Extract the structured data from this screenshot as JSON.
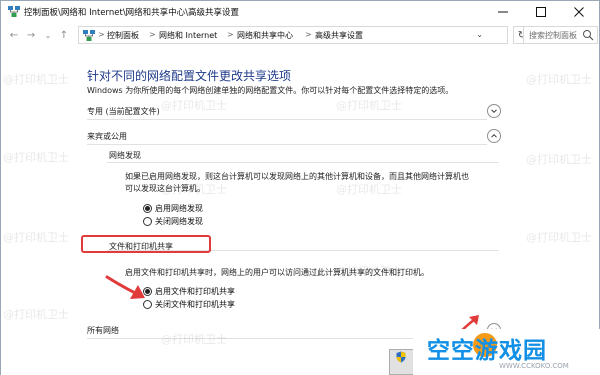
{
  "window": {
    "title": "控制面板\\网络和 Internet\\网络和共享中心\\高级共享设置",
    "minimize_icon": "minimize-icon",
    "maximize_icon": "maximize-icon",
    "close_icon": "close-icon"
  },
  "navbar": {
    "breadcrumbs": [
      "控制面板",
      "网络和 Internet",
      "网络和共享中心",
      "高级共享设置"
    ],
    "separator": ">",
    "search_placeholder": "搜索控制面板"
  },
  "content": {
    "heading": "针对不同的网络配置文件更改共享选项",
    "description": "Windows 为你所使用的每个网络创建单独的网络配置文件。你可以针对每个配置文件选择特定的选项。",
    "profiles": [
      {
        "label": "专用 (当前配置文件)",
        "expanded": false
      },
      {
        "label": "来宾或公用",
        "expanded": true
      },
      {
        "label": "所有网络",
        "expanded": false
      }
    ],
    "network_discovery": {
      "label": "网络发现",
      "text_line1": "如果已启用网络发现，则这台计算机可以发现网络上的其他计算机和设备，而且其他网络计算机也",
      "text_line2": "可以发现这台计算机。",
      "options": [
        {
          "label": "启用网络发现",
          "selected": true
        },
        {
          "label": "关闭网络发现",
          "selected": false
        }
      ]
    },
    "file_printer_sharing": {
      "label": "文件和打印机共享",
      "text": "启用文件和打印机共享时，网络上的用户可以访问通过此计算机共享的文件和打印机。",
      "options": [
        {
          "label": "启用文件和打印机共享",
          "selected": true
        },
        {
          "label": "关闭文件和打印机共享",
          "selected": false
        }
      ]
    }
  },
  "watermark": "@打印机卫士",
  "logo": {
    "text": "空空游戏园",
    "sub": "WWW.CCKOKO.COM"
  },
  "colors": {
    "heading": "#1e3a8a",
    "annotation_red": "#e03a3a",
    "logo_blue": "#1290e6",
    "logo_orange": "#f39a18"
  }
}
